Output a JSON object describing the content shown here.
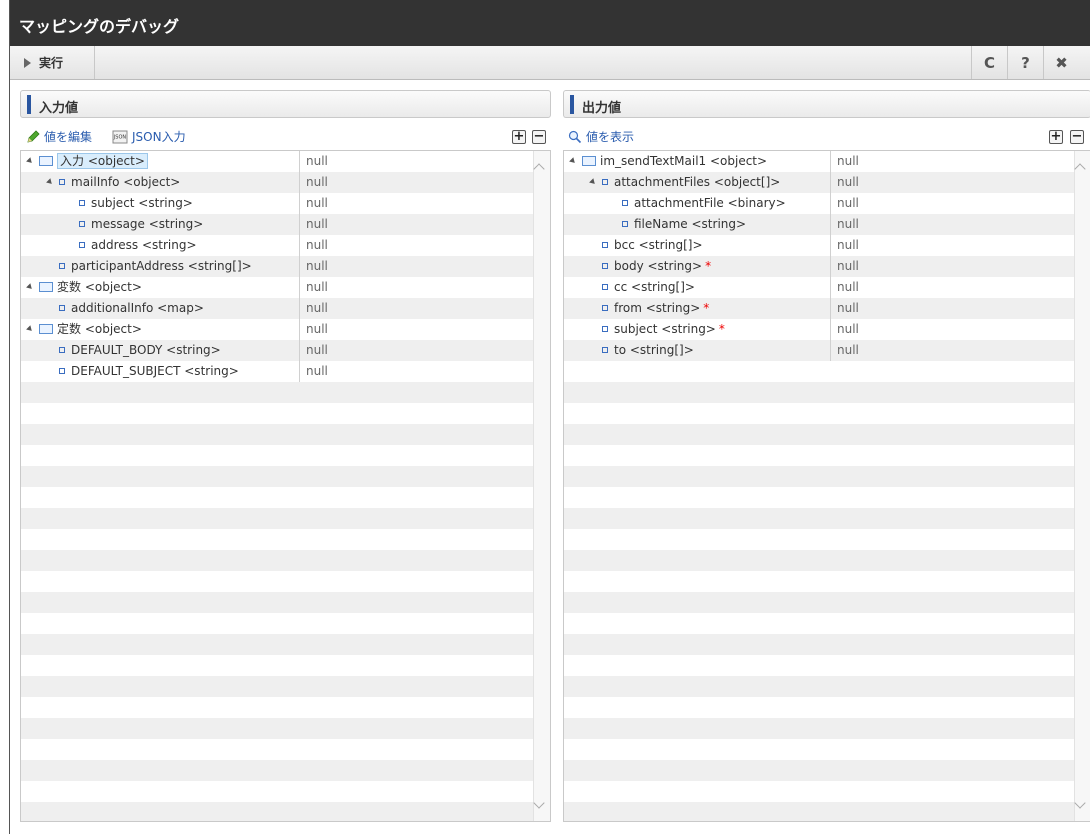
{
  "window": {
    "title": "マッピングのデバッグ"
  },
  "toolbar": {
    "run_label": "実行",
    "refresh_glyph": "C",
    "help_glyph": "?",
    "close_glyph": "✖"
  },
  "input_panel": {
    "title": "入力値",
    "edit_label": "値を編集",
    "json_label": "JSON入力",
    "expand_glyph": "+",
    "collapse_glyph": "−",
    "rows": [
      {
        "name": "入力 <object>",
        "value": "null",
        "level": 0,
        "kind": "folder",
        "expanded": true,
        "selected": true
      },
      {
        "name": "mailInfo <object>",
        "value": "null",
        "level": 1,
        "kind": "leaf",
        "expanded": true
      },
      {
        "name": "subject <string>",
        "value": "null",
        "level": 2,
        "kind": "leaf"
      },
      {
        "name": "message <string>",
        "value": "null",
        "level": 2,
        "kind": "leaf"
      },
      {
        "name": "address <string>",
        "value": "null",
        "level": 2,
        "kind": "leaf"
      },
      {
        "name": "participantAddress <string[]>",
        "value": "null",
        "level": 1,
        "kind": "leaf"
      },
      {
        "name": "変数 <object>",
        "value": "null",
        "level": 0,
        "kind": "folder",
        "expanded": true
      },
      {
        "name": "additionalInfo <map>",
        "value": "null",
        "level": 1,
        "kind": "leaf"
      },
      {
        "name": "定数 <object>",
        "value": "null",
        "level": 0,
        "kind": "folder",
        "expanded": true
      },
      {
        "name": "DEFAULT_BODY <string>",
        "value": "null",
        "level": 1,
        "kind": "leaf"
      },
      {
        "name": "DEFAULT_SUBJECT <string>",
        "value": "null",
        "level": 1,
        "kind": "leaf"
      }
    ]
  },
  "output_panel": {
    "title": "出力値",
    "show_label": "値を表示",
    "expand_glyph": "+",
    "collapse_glyph": "−",
    "rows": [
      {
        "name": "im_sendTextMail1 <object>",
        "value": "null",
        "level": 0,
        "kind": "folder",
        "expanded": true
      },
      {
        "name": "attachmentFiles <object[]>",
        "value": "null",
        "level": 1,
        "kind": "leaf",
        "expanded": true
      },
      {
        "name": "attachmentFile <binary>",
        "value": "null",
        "level": 2,
        "kind": "leaf"
      },
      {
        "name": "fileName <string>",
        "value": "null",
        "level": 2,
        "kind": "leaf"
      },
      {
        "name": "bcc <string[]>",
        "value": "null",
        "level": 1,
        "kind": "leaf"
      },
      {
        "name": "body <string>",
        "value": "null",
        "level": 1,
        "kind": "leaf",
        "required": "*"
      },
      {
        "name": "cc <string[]>",
        "value": "null",
        "level": 1,
        "kind": "leaf"
      },
      {
        "name": "from <string>",
        "value": "null",
        "level": 1,
        "kind": "leaf",
        "required": "*"
      },
      {
        "name": "subject <string>",
        "value": "null",
        "level": 1,
        "kind": "leaf",
        "required": "*"
      },
      {
        "name": "to <string[]>",
        "value": "null",
        "level": 1,
        "kind": "leaf"
      }
    ]
  }
}
